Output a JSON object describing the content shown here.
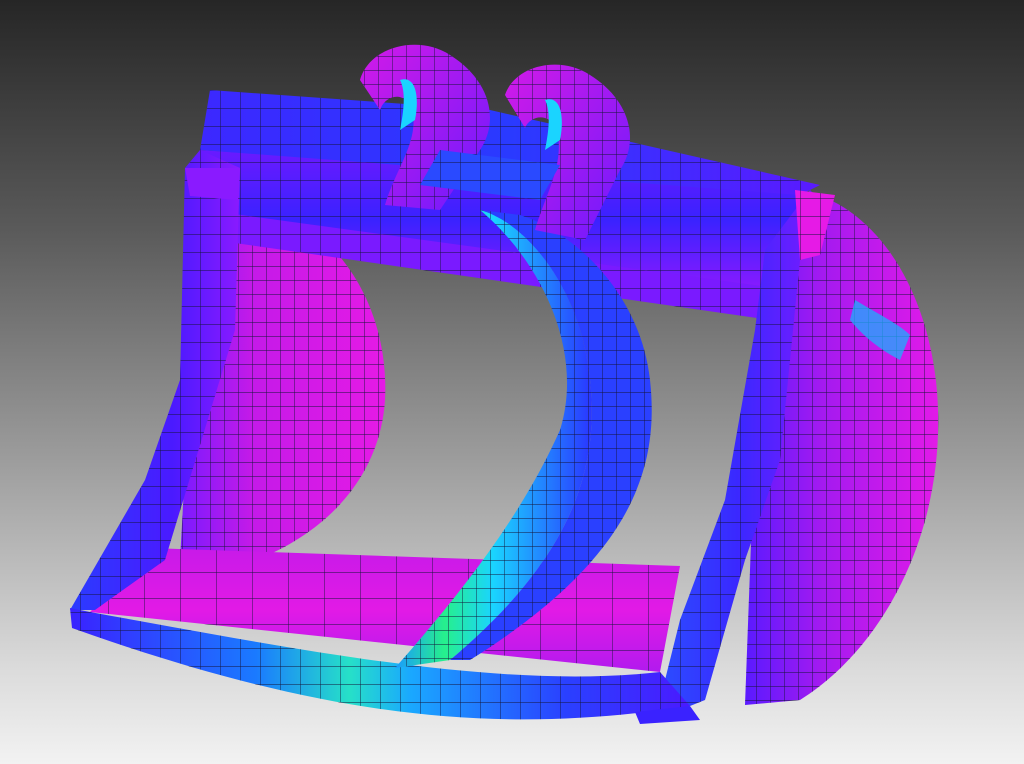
{
  "viewport": {
    "background": {
      "top": "#262626",
      "bottom": "#f2f2f2"
    }
  },
  "model": {
    "type": "fea-mesh-bucket",
    "mesh_line_color": "#1a1a3a",
    "stress_colors": {
      "lowest": "#e61ae6",
      "low": "#8a1aff",
      "mid_low": "#3a2aff",
      "mid": "#1a6aff",
      "mid_high": "#1ad4ff",
      "highest": "#26f08c"
    }
  }
}
